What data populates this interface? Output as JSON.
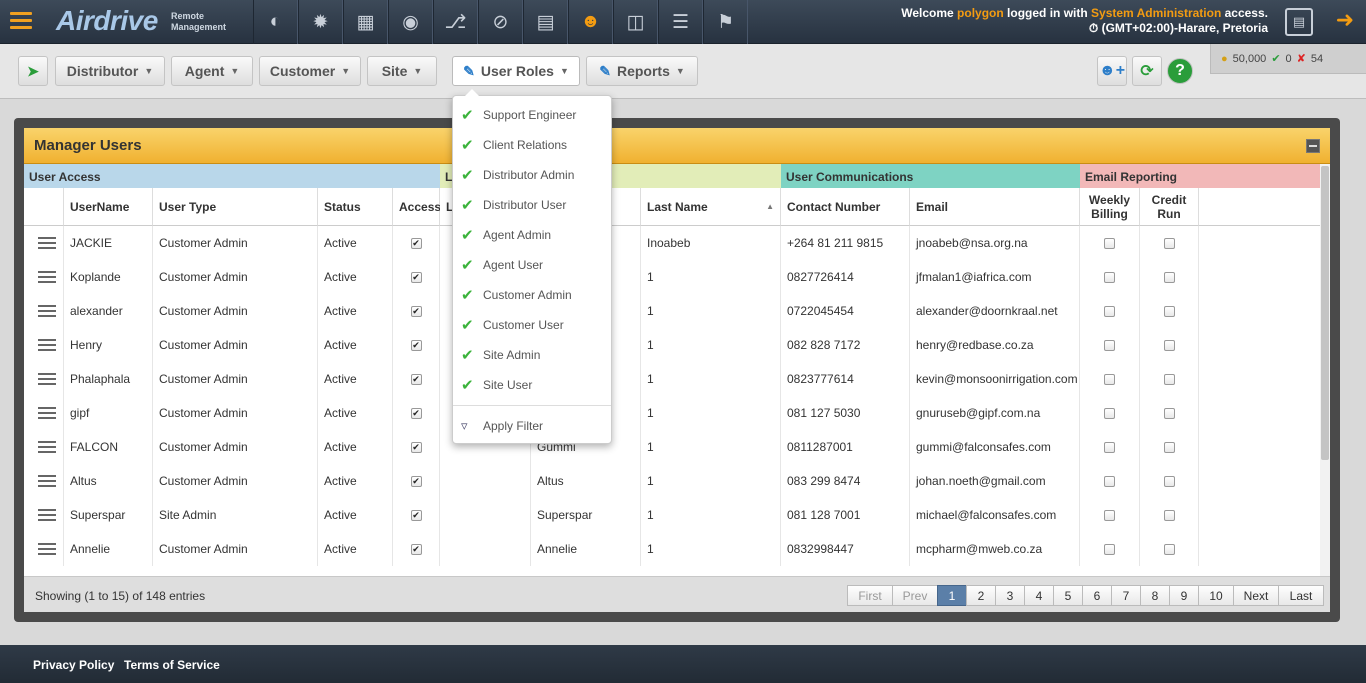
{
  "header": {
    "logo": "Airdrive",
    "logo_sub_1": "Remote",
    "logo_sub_2": "Management",
    "welcome_prefix": "Welcome ",
    "username": "polygon",
    "welcome_mid": " logged in with ",
    "access_level": "System Administration",
    "welcome_suffix": " access.",
    "timezone": "(GMT+02:00)-Harare, Pretoria",
    "nav_icons": [
      "speedometer-icon",
      "gear-burst-icon",
      "grid-icon",
      "eye-icon",
      "network-icon",
      "no-dollar-icon",
      "document-icon",
      "users-icon",
      "book-icon",
      "list-icon",
      "bell-icon"
    ]
  },
  "toolbar": {
    "distributor": "Distributor",
    "agent": "Agent",
    "customer": "Customer",
    "site": "Site",
    "user_roles": "User Roles",
    "reports": "Reports"
  },
  "stats": {
    "coins": "50,000",
    "ok": "0",
    "err": "54"
  },
  "panel": {
    "title": "Manager Users"
  },
  "groups": {
    "user_access": "User Access",
    "l": "L",
    "user_comms": "User Communications",
    "email_reporting": "Email Reporting"
  },
  "columns": {
    "username": "UserName",
    "user_type": "User Type",
    "status": "Status",
    "access": "Access",
    "l": "L",
    "last_name": "Last Name",
    "contact": "Contact Number",
    "email": "Email",
    "weekly_1": "Weekly",
    "weekly_2": "Billing",
    "credit_1": "Credit",
    "credit_2": "Run"
  },
  "rows": [
    {
      "username": "JACKIE",
      "type": "Customer Admin",
      "status": "Active",
      "first": "",
      "last": "Inoabeb",
      "contact": "+264 81 211 9815",
      "email": "jnoabeb@nsa.org.na"
    },
    {
      "username": "Koplande",
      "type": "Customer Admin",
      "status": "Active",
      "first": "",
      "last": "1",
      "contact": "0827726414",
      "email": "jfmalan1@iafrica.com"
    },
    {
      "username": "alexander",
      "type": "Customer Admin",
      "status": "Active",
      "first": "",
      "last": "1",
      "contact": "0722045454",
      "email": "alexander@doornkraal.net"
    },
    {
      "username": "Henry",
      "type": "Customer Admin",
      "status": "Active",
      "first": "",
      "last": "1",
      "contact": "082 828 7172",
      "email": "henry@redbase.co.za"
    },
    {
      "username": "Phalaphala",
      "type": "Customer Admin",
      "status": "Active",
      "first": "",
      "last": "1",
      "contact": "0823777614",
      "email": "kevin@monsoonirrigation.com"
    },
    {
      "username": "gipf",
      "type": "Customer Admin",
      "status": "Active",
      "first": "",
      "last": "1",
      "contact": "081 127 5030",
      "email": "gnuruseb@gipf.com.na"
    },
    {
      "username": "FALCON",
      "type": "Customer Admin",
      "status": "Active",
      "first": "Gummi",
      "last": "1",
      "contact": "0811287001",
      "email": "gummi@falconsafes.com"
    },
    {
      "username": "Altus",
      "type": "Customer Admin",
      "status": "Active",
      "first": "Altus",
      "last": "1",
      "contact": "083 299 8474",
      "email": "johan.noeth@gmail.com"
    },
    {
      "username": "Superspar",
      "type": "Site Admin",
      "status": "Active",
      "first": "Superspar",
      "last": "1",
      "contact": "081 128 7001",
      "email": "michael@falconsafes.com"
    },
    {
      "username": "Annelie",
      "type": "Customer Admin",
      "status": "Active",
      "first": "Annelie",
      "last": "1",
      "contact": "0832998447",
      "email": "mcpharm@mweb.co.za"
    }
  ],
  "roles_menu": {
    "items": [
      "Support Engineer",
      "Client Relations",
      "Distributor Admin",
      "Distributor User",
      "Agent Admin",
      "Agent User",
      "Customer Admin",
      "Customer User",
      "Site Admin",
      "Site User"
    ],
    "apply": "Apply Filter"
  },
  "footer_bar": {
    "showing": "Showing (1 to 15) of 148 entries",
    "first": "First",
    "prev": "Prev",
    "pages": [
      "1",
      "2",
      "3",
      "4",
      "5",
      "6",
      "7",
      "8",
      "9",
      "10"
    ],
    "next": "Next",
    "last": "Last"
  },
  "footer": {
    "privacy": "Privacy Policy",
    "terms": "Terms of Service"
  },
  "colors": {
    "accent": "#f39c12",
    "user_access": "#b9d7ea",
    "l_group": "#e2edb8",
    "comms": "#7ed3c3",
    "email_rep": "#f2b8b8"
  }
}
